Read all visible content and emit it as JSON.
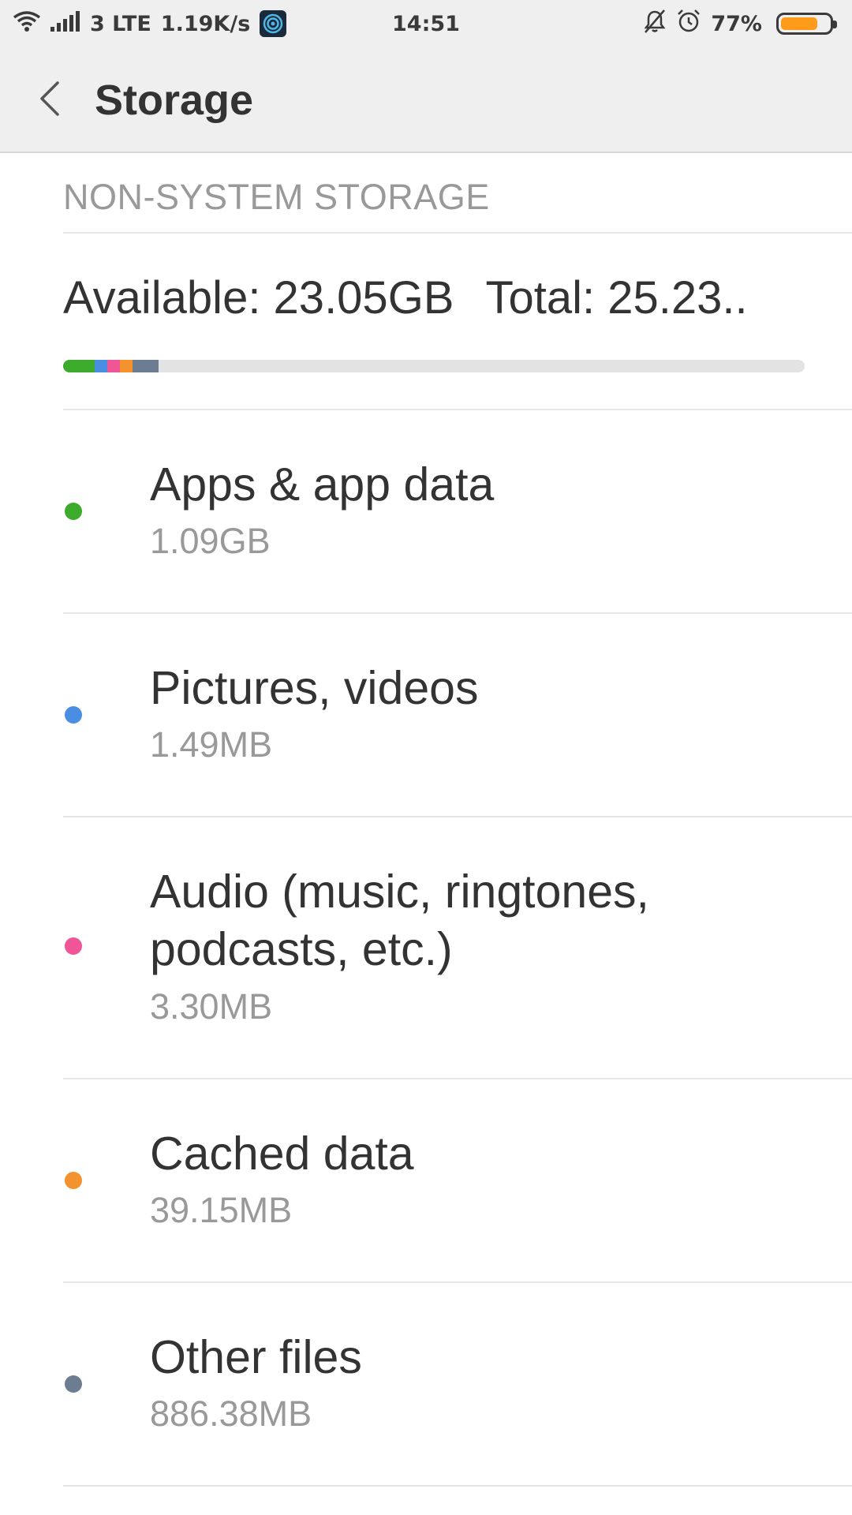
{
  "status_bar": {
    "network_type": "3 LTE",
    "speed": "1.19K/s",
    "time": "14:51",
    "battery_percent_text": "77%",
    "battery_level": 0.77,
    "battery_color": "#ff9b1a",
    "icons": [
      "wifi-icon",
      "signal-icon",
      "app-notification-icon",
      "mute-icon",
      "alarm-icon",
      "battery-icon"
    ]
  },
  "header": {
    "back_icon": "chevron-left-icon",
    "title": "Storage"
  },
  "section": {
    "title": "NON-SYSTEM STORAGE"
  },
  "summary": {
    "available": "Available: 23.05GB",
    "total": "Total: 25.23.."
  },
  "storage_bar": {
    "segments": [
      {
        "name": "apps",
        "color": "#3cab2c",
        "fraction": 0.043
      },
      {
        "name": "pictures",
        "color": "#4a8ee3",
        "fraction": 0.017
      },
      {
        "name": "audio",
        "color": "#f05598",
        "fraction": 0.017
      },
      {
        "name": "cached",
        "color": "#f4922e",
        "fraction": 0.017
      },
      {
        "name": "other",
        "color": "#6d7d91",
        "fraction": 0.035
      }
    ],
    "track_color": "#e3e3e3"
  },
  "categories": [
    {
      "label": "Apps & app data",
      "size": "1.09GB",
      "color": "#3cab2c"
    },
    {
      "label": "Pictures, videos",
      "size": "1.49MB",
      "color": "#4a8ee3"
    },
    {
      "label": "Audio (music, ringtones, podcasts, etc.)",
      "label_line1": "Audio (music, ringtones,",
      "label_line2": "podcasts, etc.)",
      "size": "3.30MB",
      "color": "#f05598"
    },
    {
      "label": "Cached data",
      "size": "39.15MB",
      "color": "#f4922e"
    },
    {
      "label": "Other files",
      "size": "886.38MB",
      "color": "#6d7d91"
    }
  ]
}
